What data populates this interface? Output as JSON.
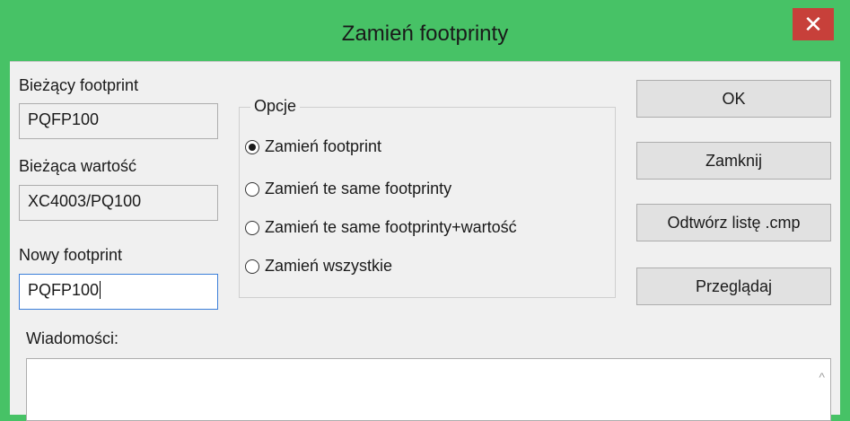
{
  "window": {
    "title": "Zamień footprinty",
    "close_glyph": "✕"
  },
  "current_footprint": {
    "label": "Bieżący footprint",
    "value": "PQFP100"
  },
  "current_value": {
    "label": "Bieżąca wartość",
    "value": "XC4003/PQ100"
  },
  "new_footprint": {
    "label": "Nowy footprint",
    "value": "PQFP100"
  },
  "options": {
    "legend": "Opcje",
    "items": [
      {
        "label": "Zamień footprint",
        "checked": true
      },
      {
        "label": "Zamień te same footprinty",
        "checked": false
      },
      {
        "label": "Zamień te same footprinty+wartość",
        "checked": false
      },
      {
        "label": "Zamień wszystkie",
        "checked": false
      }
    ]
  },
  "buttons": {
    "ok": "OK",
    "close": "Zamknij",
    "restore_cmp": "Odtwórz listę .cmp",
    "browse": "Przeglądaj"
  },
  "messages": {
    "label": "Wiadomości:",
    "scroll_up_glyph": "^"
  },
  "colors": {
    "titlebar": "#47c266",
    "close_button": "#c7403a",
    "dialog_bg": "#f0f0f0",
    "focus_border": "#3c7fd9"
  },
  "icons": {
    "close": "close-icon",
    "scroll_up": "scroll-up-icon"
  }
}
